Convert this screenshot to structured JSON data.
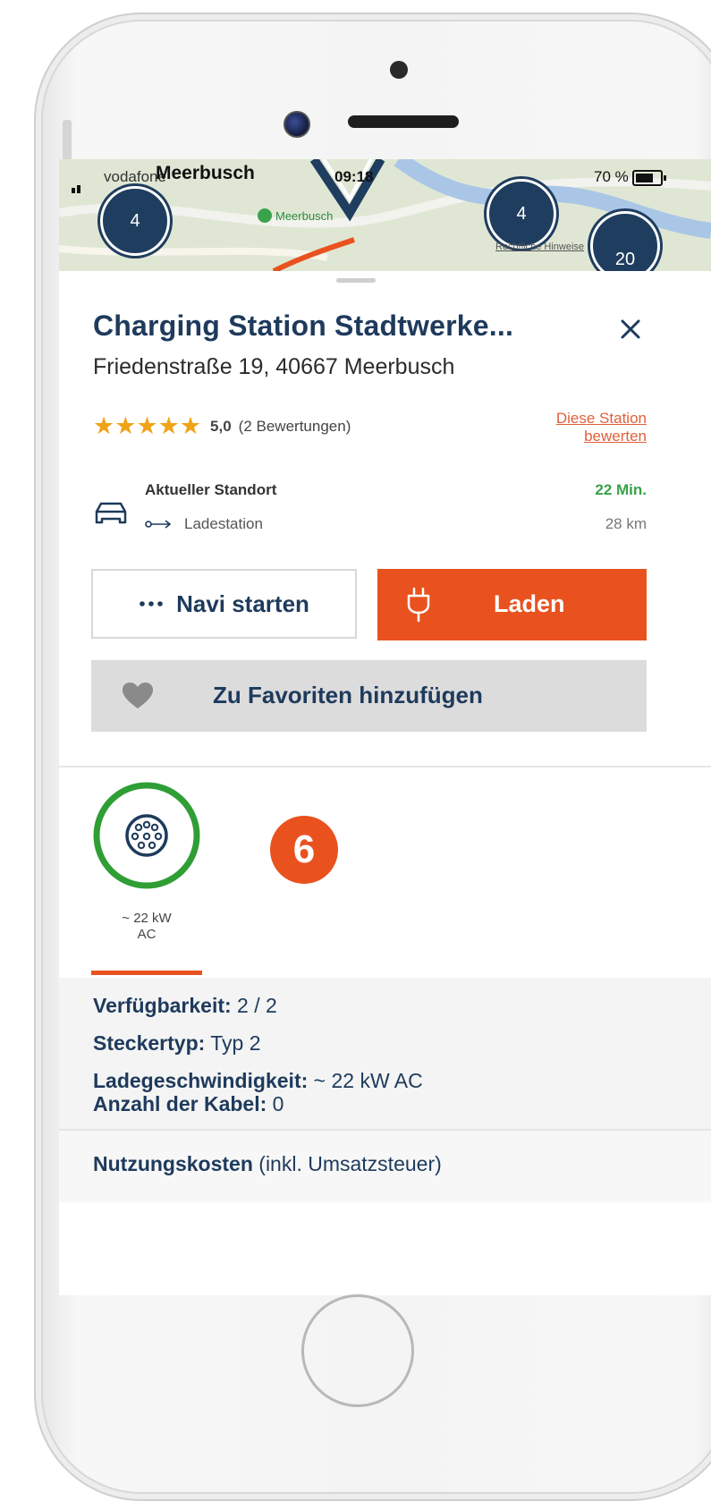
{
  "status_bar": {
    "carrier": "vodafone",
    "time": "09:18",
    "battery": "70 %"
  },
  "map": {
    "city_label": "Meerbusch",
    "place_label": "Meerbusch",
    "clusters": [
      "4",
      "4",
      "20"
    ],
    "legal_link": "Rechtliche Hinweise"
  },
  "station": {
    "title": "Charging Station Stadtwerke...",
    "address": "Friedenstraße 19, 40667 Meerbusch",
    "stars": "★★★★★",
    "rating_value": "5,0",
    "rating_count": "(2 Bewertungen)",
    "rate_link_line1": "Diese Station",
    "rate_link_line2": "bewerten"
  },
  "route": {
    "from_label": "Aktueller Standort",
    "to_label": "Ladestation",
    "duration": "22 Min.",
    "distance": "28 km"
  },
  "actions": {
    "navi_label": "Navi starten",
    "charge_label": "Laden",
    "favorite_label": "Zu Favoriten hinzufügen"
  },
  "connector": {
    "power_line1": "~ 22 kW",
    "power_line2": "AC",
    "badge": "6"
  },
  "details": {
    "availability_label": "Verfügbarkeit:",
    "availability_value": "2 / 2",
    "plug_type_label": "Steckertyp:",
    "plug_type_value": "Typ 2",
    "speed_label": "Ladegeschwindigkeit:",
    "speed_value": "~ 22 kW AC",
    "cables_label": "Anzahl der Kabel:",
    "cables_value": "0"
  },
  "costs": {
    "label": "Nutzungskosten",
    "note": "(inkl. Umsatzsteuer)"
  },
  "colors": {
    "accent": "#e9521f",
    "navy": "#1e3a5c",
    "green": "#3aa24a",
    "star": "#f0a318"
  }
}
